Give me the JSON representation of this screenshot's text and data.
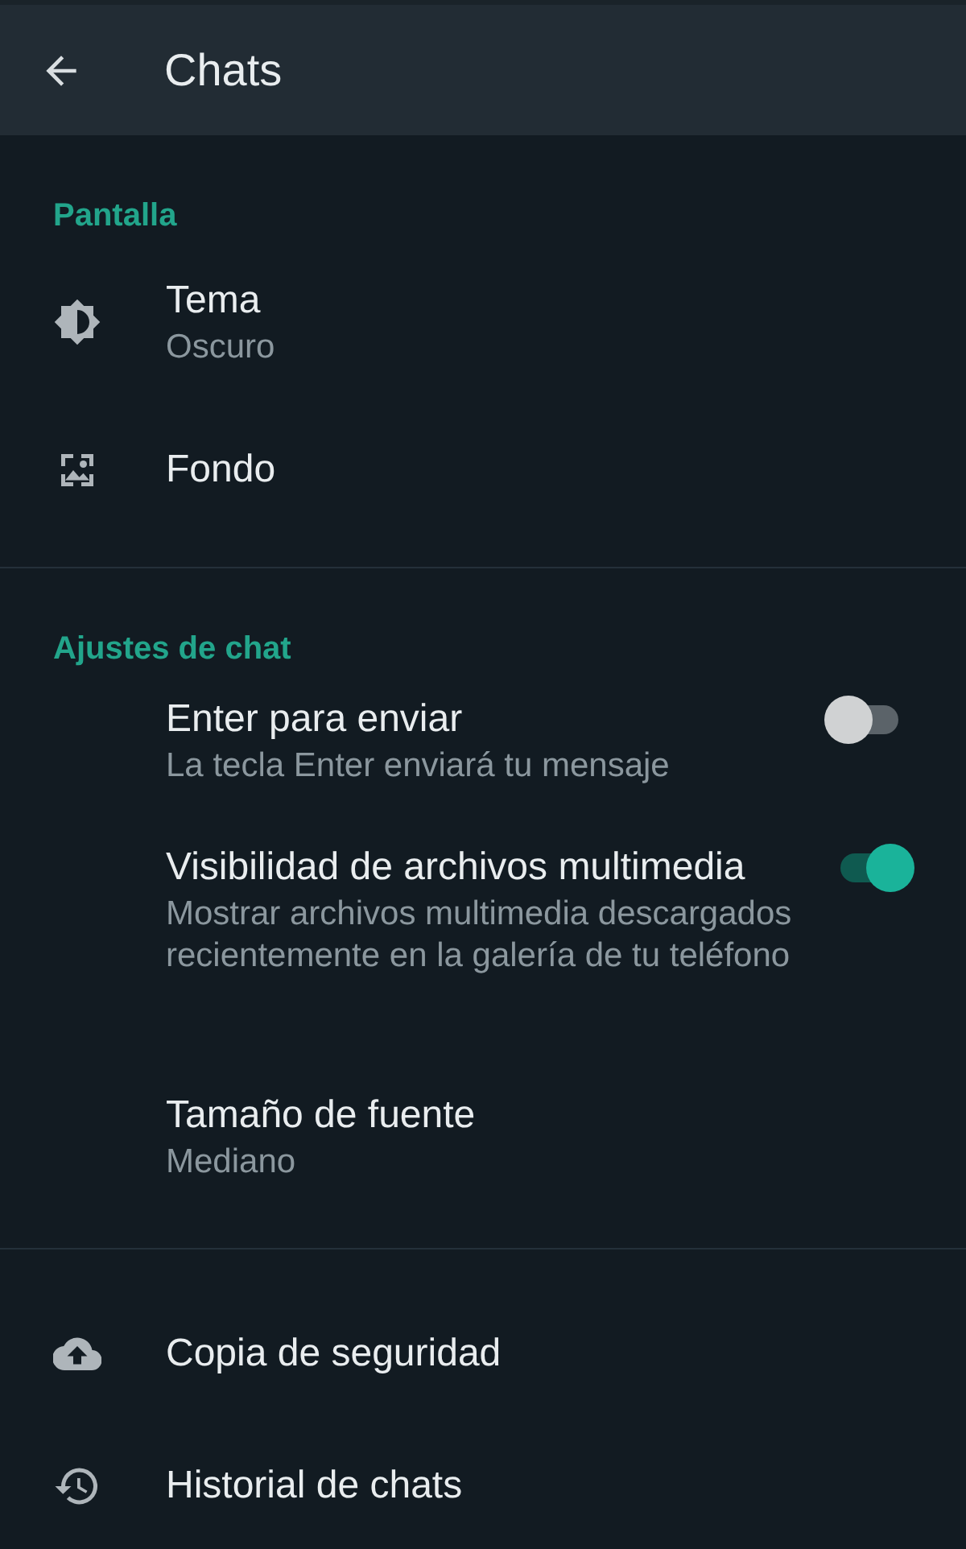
{
  "header": {
    "title": "Chats"
  },
  "sections": [
    {
      "title": "Pantalla",
      "items": [
        {
          "kind": "icon",
          "title": "Tema",
          "subtitle": "Oscuro"
        },
        {
          "kind": "icon",
          "title": "Fondo"
        }
      ]
    },
    {
      "title": "Ajustes de chat",
      "items": [
        {
          "kind": "toggle",
          "title": "Enter para enviar",
          "subtitle": "La tecla Enter enviará tu mensaje",
          "on": false
        },
        {
          "kind": "toggle",
          "title": "Visibilidad de archivos multimedia",
          "subtitle": "Mostrar archivos multimedia descargados recientemente en la galería de tu teléfono",
          "on": true
        },
        {
          "kind": "plain",
          "title": "Tamaño de fuente",
          "subtitle": "Mediano"
        }
      ]
    },
    {
      "items": [
        {
          "kind": "icon",
          "title": "Copia de seguridad"
        },
        {
          "kind": "icon",
          "title": "Historial de chats"
        }
      ]
    }
  ]
}
